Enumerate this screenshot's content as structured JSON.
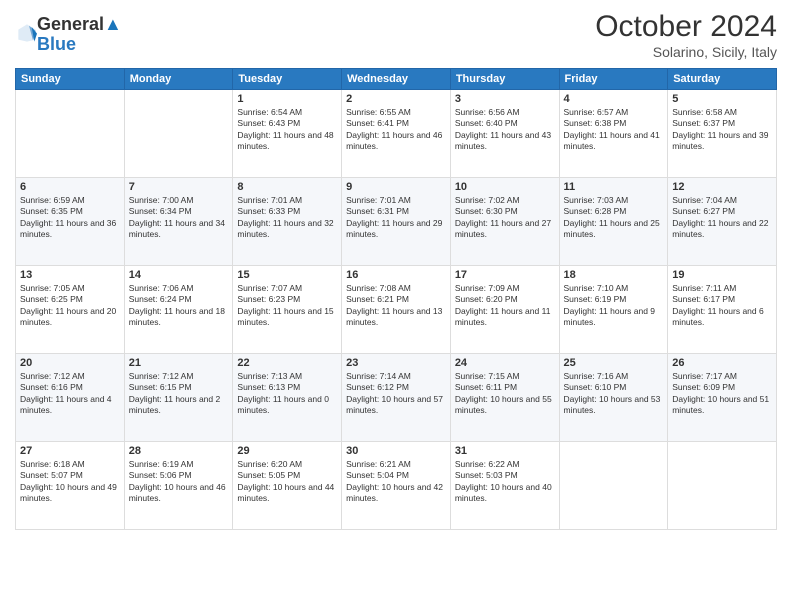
{
  "header": {
    "logo_line1": "General",
    "logo_line2": "Blue",
    "month": "October 2024",
    "location": "Solarino, Sicily, Italy"
  },
  "weekdays": [
    "Sunday",
    "Monday",
    "Tuesday",
    "Wednesday",
    "Thursday",
    "Friday",
    "Saturday"
  ],
  "weeks": [
    [
      {
        "day": "",
        "info": ""
      },
      {
        "day": "",
        "info": ""
      },
      {
        "day": "1",
        "info": "Sunrise: 6:54 AM\nSunset: 6:43 PM\nDaylight: 11 hours and 48 minutes."
      },
      {
        "day": "2",
        "info": "Sunrise: 6:55 AM\nSunset: 6:41 PM\nDaylight: 11 hours and 46 minutes."
      },
      {
        "day": "3",
        "info": "Sunrise: 6:56 AM\nSunset: 6:40 PM\nDaylight: 11 hours and 43 minutes."
      },
      {
        "day": "4",
        "info": "Sunrise: 6:57 AM\nSunset: 6:38 PM\nDaylight: 11 hours and 41 minutes."
      },
      {
        "day": "5",
        "info": "Sunrise: 6:58 AM\nSunset: 6:37 PM\nDaylight: 11 hours and 39 minutes."
      }
    ],
    [
      {
        "day": "6",
        "info": "Sunrise: 6:59 AM\nSunset: 6:35 PM\nDaylight: 11 hours and 36 minutes."
      },
      {
        "day": "7",
        "info": "Sunrise: 7:00 AM\nSunset: 6:34 PM\nDaylight: 11 hours and 34 minutes."
      },
      {
        "day": "8",
        "info": "Sunrise: 7:01 AM\nSunset: 6:33 PM\nDaylight: 11 hours and 32 minutes."
      },
      {
        "day": "9",
        "info": "Sunrise: 7:01 AM\nSunset: 6:31 PM\nDaylight: 11 hours and 29 minutes."
      },
      {
        "day": "10",
        "info": "Sunrise: 7:02 AM\nSunset: 6:30 PM\nDaylight: 11 hours and 27 minutes."
      },
      {
        "day": "11",
        "info": "Sunrise: 7:03 AM\nSunset: 6:28 PM\nDaylight: 11 hours and 25 minutes."
      },
      {
        "day": "12",
        "info": "Sunrise: 7:04 AM\nSunset: 6:27 PM\nDaylight: 11 hours and 22 minutes."
      }
    ],
    [
      {
        "day": "13",
        "info": "Sunrise: 7:05 AM\nSunset: 6:25 PM\nDaylight: 11 hours and 20 minutes."
      },
      {
        "day": "14",
        "info": "Sunrise: 7:06 AM\nSunset: 6:24 PM\nDaylight: 11 hours and 18 minutes."
      },
      {
        "day": "15",
        "info": "Sunrise: 7:07 AM\nSunset: 6:23 PM\nDaylight: 11 hours and 15 minutes."
      },
      {
        "day": "16",
        "info": "Sunrise: 7:08 AM\nSunset: 6:21 PM\nDaylight: 11 hours and 13 minutes."
      },
      {
        "day": "17",
        "info": "Sunrise: 7:09 AM\nSunset: 6:20 PM\nDaylight: 11 hours and 11 minutes."
      },
      {
        "day": "18",
        "info": "Sunrise: 7:10 AM\nSunset: 6:19 PM\nDaylight: 11 hours and 9 minutes."
      },
      {
        "day": "19",
        "info": "Sunrise: 7:11 AM\nSunset: 6:17 PM\nDaylight: 11 hours and 6 minutes."
      }
    ],
    [
      {
        "day": "20",
        "info": "Sunrise: 7:12 AM\nSunset: 6:16 PM\nDaylight: 11 hours and 4 minutes."
      },
      {
        "day": "21",
        "info": "Sunrise: 7:12 AM\nSunset: 6:15 PM\nDaylight: 11 hours and 2 minutes."
      },
      {
        "day": "22",
        "info": "Sunrise: 7:13 AM\nSunset: 6:13 PM\nDaylight: 11 hours and 0 minutes."
      },
      {
        "day": "23",
        "info": "Sunrise: 7:14 AM\nSunset: 6:12 PM\nDaylight: 10 hours and 57 minutes."
      },
      {
        "day": "24",
        "info": "Sunrise: 7:15 AM\nSunset: 6:11 PM\nDaylight: 10 hours and 55 minutes."
      },
      {
        "day": "25",
        "info": "Sunrise: 7:16 AM\nSunset: 6:10 PM\nDaylight: 10 hours and 53 minutes."
      },
      {
        "day": "26",
        "info": "Sunrise: 7:17 AM\nSunset: 6:09 PM\nDaylight: 10 hours and 51 minutes."
      }
    ],
    [
      {
        "day": "27",
        "info": "Sunrise: 6:18 AM\nSunset: 5:07 PM\nDaylight: 10 hours and 49 minutes."
      },
      {
        "day": "28",
        "info": "Sunrise: 6:19 AM\nSunset: 5:06 PM\nDaylight: 10 hours and 46 minutes."
      },
      {
        "day": "29",
        "info": "Sunrise: 6:20 AM\nSunset: 5:05 PM\nDaylight: 10 hours and 44 minutes."
      },
      {
        "day": "30",
        "info": "Sunrise: 6:21 AM\nSunset: 5:04 PM\nDaylight: 10 hours and 42 minutes."
      },
      {
        "day": "31",
        "info": "Sunrise: 6:22 AM\nSunset: 5:03 PM\nDaylight: 10 hours and 40 minutes."
      },
      {
        "day": "",
        "info": ""
      },
      {
        "day": "",
        "info": ""
      }
    ]
  ]
}
